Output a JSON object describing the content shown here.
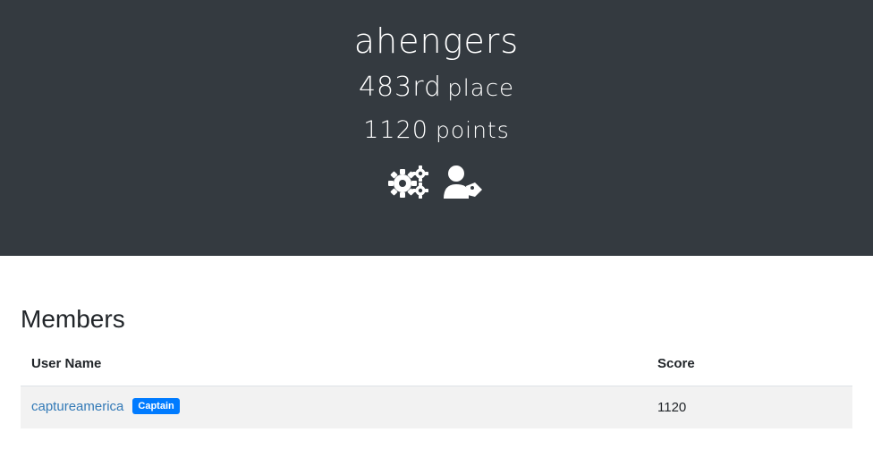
{
  "team": {
    "name": "ahengers",
    "place_number": "483",
    "place_suffix": "rd",
    "place_word": "place",
    "points_number": "1120",
    "points_word": "points"
  },
  "icons": {
    "settings": "gears-icon",
    "user_tag": "user-tag-icon"
  },
  "members": {
    "title": "Members",
    "columns": [
      "User Name",
      "Score"
    ],
    "rows": [
      {
        "user": "captureamerica",
        "badge": "Captain",
        "score": "1120"
      }
    ]
  },
  "colors": {
    "header_bg": "#343a40",
    "link": "#337ab7",
    "badge": "#007bff",
    "row_bg": "#f2f2f2"
  }
}
